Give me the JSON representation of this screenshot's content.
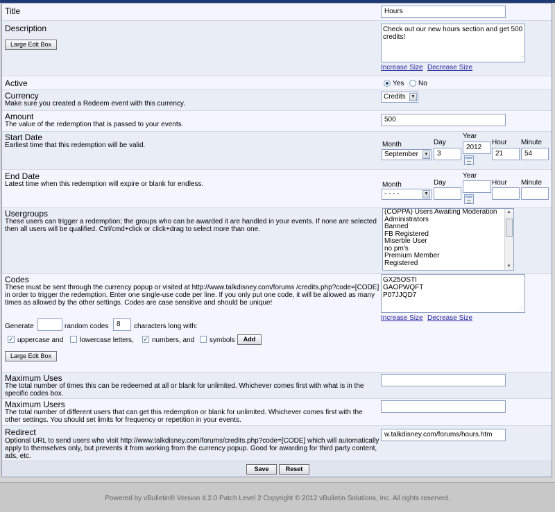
{
  "form": {
    "title": {
      "label": "Title",
      "value": "Hours"
    },
    "description": {
      "label": "Description",
      "value": "Check out our new hours section and get 500 credits!",
      "large_edit_box": "Large Edit Box",
      "increase_size": "Increase Size",
      "decrease_size": "Decrease Size"
    },
    "active": {
      "label": "Active",
      "yes": "Yes",
      "no": "No",
      "selected": "Yes"
    },
    "currency": {
      "label": "Currency",
      "desc": "Make sure you created a Redeem event with this currency.",
      "selected": "Credits"
    },
    "amount": {
      "label": "Amount",
      "desc": "The value of the redemption that is passed to your events.",
      "value": "500"
    },
    "start_date": {
      "label": "Start Date",
      "desc": "Earliest time that this redemption will be valid.",
      "month_label": "Month",
      "day_label": "Day",
      "year_label": "Year",
      "hour_label": "Hour",
      "minute_label": "Minute",
      "month": "September",
      "day": "3",
      "year": "2012",
      "hour": "21",
      "minute": "54"
    },
    "end_date": {
      "label": "End Date",
      "desc": "Latest time when this redemption will expire or blank for endless.",
      "month_label": "Month",
      "day_label": "Day",
      "year_label": "Year",
      "hour_label": "Hour",
      "minute_label": "Minute",
      "month": "- - - -",
      "day": "",
      "year": "",
      "hour": "",
      "minute": ""
    },
    "usergroups": {
      "label": "Usergroups",
      "desc": "These users can trigger a redemption; the groups who can be awarded it are handled in your events. If none are selected then all users will be qualified. Ctrl/cmd+click or click+drag to select more than one.",
      "options": [
        "(COPPA) Users Awaiting Moderation",
        "Administrators",
        "Banned",
        "FB Registered",
        "Miserble User",
        "no pm's",
        "Premium Member",
        "Registered"
      ]
    },
    "codes": {
      "label": "Codes",
      "desc": "These must be sent through the currency popup or visited at http://www.talkdisney.com/forums /credits.php?code=[CODE] in order to trigger the redemption. Enter one single-use code per line. If you only put one code, it will be allowed as many times as allowed by the other settings. Codes are case sensitive and should be unique!",
      "lines": [
        "GX25OSTI",
        "GAOPWQFT",
        "P07JJQD7"
      ],
      "increase_size": "Increase Size",
      "decrease_size": "Decrease Size",
      "generate_label": "Generate",
      "generate_count": "",
      "random_codes_label": "random codes",
      "length": "8",
      "chars_label": "characters long with:",
      "uppercase_label": "uppercase and",
      "lowercase_label": "lowercase letters,",
      "numbers_label": "numbers, and",
      "symbols_label": "symbols",
      "add_label": "Add",
      "large_edit_box": "Large Edit Box"
    },
    "max_uses": {
      "label": "Maximum Uses",
      "desc": "The total number of times this can be redeemed at all or blank for unlimited. Whichever comes first with what is in the specific codes box.",
      "value": ""
    },
    "max_users": {
      "label": "Maximum Users",
      "desc": "The total number of different users that can get this redemption or blank for unlimited. Whichever comes first with the other settings. You should set limits for frequency or repetition in your events.",
      "value": ""
    },
    "redirect": {
      "label": "Redirect",
      "desc": "Optional URL to send users who visit http://www.talkdisney.com/forums/credits.php?code=[CODE] which will automatically apply to themselves only, but prevents it from working from the currency popup. Good for awarding for third party content, ads, etc.",
      "value": "w.talkdisney.com/forums/hours.htm"
    },
    "save_label": "Save",
    "reset_label": "Reset"
  },
  "footer": {
    "text": "Powered by vBulletin® Version 4.2.0 Patch Level 2 Copyright © 2012 vBulletin Solutions, Inc. All rights reserved."
  }
}
